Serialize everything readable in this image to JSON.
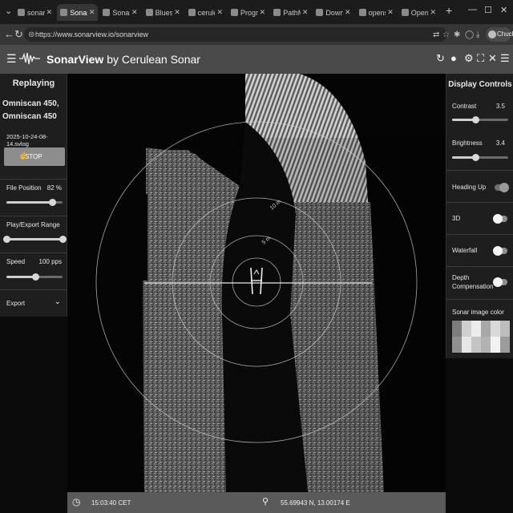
{
  "browser": {
    "tabs": [
      {
        "title": "sonarview",
        "active": false
      },
      {
        "title": "SonarView",
        "active": true
      },
      {
        "title": "SonarView",
        "active": false
      },
      {
        "title": "Bluesolution",
        "active": false
      },
      {
        "title": "ceruleansonar",
        "active": false
      },
      {
        "title": "Program file",
        "active": false
      },
      {
        "title": "PathMaster",
        "active": false
      },
      {
        "title": "Download fi",
        "active": false
      },
      {
        "title": "openside.co",
        "active": false
      },
      {
        "title": "Open Sidec",
        "active": false
      }
    ],
    "url": "https://www.sonarview.io/sonarview",
    "profile_label": "Chuck"
  },
  "app": {
    "brand_bold": "SonarView",
    "brand_rest": " by Cerulean Sonar"
  },
  "left_panel": {
    "heading": "Replaying",
    "device_line1": "Omniscan 450,",
    "device_line2": "Omniscan 450",
    "log_file": "2025-10-24-08-14.svlog",
    "stop_label": "STOP",
    "file_position": {
      "label": "File Position",
      "value": "82 %",
      "level": 0.82
    },
    "range": {
      "label": "Play/Export Range",
      "start": 0.0,
      "end": 1.0
    },
    "speed": {
      "label": "Speed",
      "value": "100 pps",
      "level": 0.52
    },
    "export_label": "Export"
  },
  "right_panel": {
    "heading": "Display Controls",
    "contrast": {
      "label": "Contrast",
      "value": "3.5",
      "level": 0.42
    },
    "brightness": {
      "label": "Brightness",
      "value": "3.4",
      "level": 0.42
    },
    "heading_up": {
      "label": "Heading Up",
      "on": true
    },
    "three_d": {
      "label": "3D",
      "on": false
    },
    "waterfall": {
      "label": "Waterfall",
      "on": false
    },
    "depth_comp": {
      "label1": "Depth",
      "label2": "Compensation",
      "on": false
    },
    "image_color_label": "Sonar image color",
    "palette": [
      "#7d7d7d",
      "#cfcfcf",
      "#ededed",
      "#a8a8a8",
      "#d9d9d9",
      "#bdbdbd",
      "#909090",
      "#e6e6e6",
      "#c4c4c4",
      "#b2b2b2",
      "#f2f2f2",
      "#9c9c9c"
    ]
  },
  "sonar": {
    "range_labels": [
      "10 m",
      "5 m"
    ]
  },
  "status": {
    "time": "15:03:40 CET",
    "coords": "55.69943 N, 13.00174 E"
  },
  "icons": {
    "back": "arrow-left-icon",
    "forward": "arrow-right-icon",
    "reload": "reload-icon",
    "clock": "clock-icon",
    "pin": "location-pin-icon"
  }
}
